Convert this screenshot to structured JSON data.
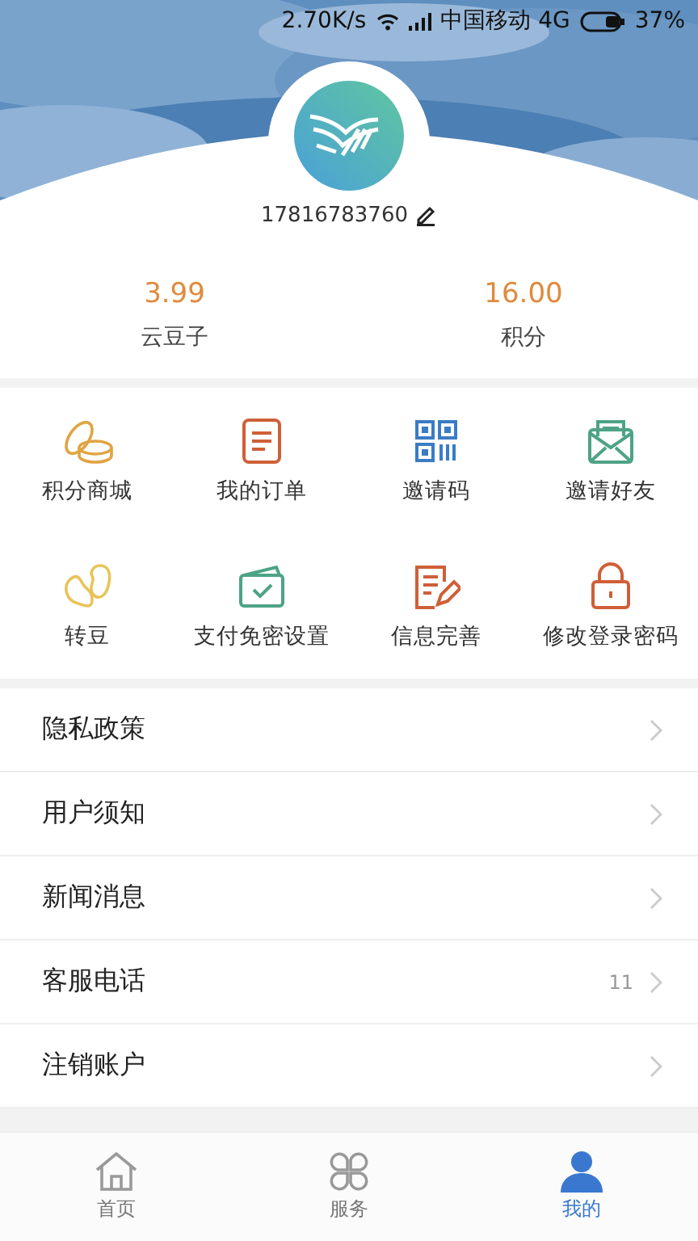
{
  "status_bar": {
    "speed": "2.70K/s",
    "carrier": "中国移动 4G",
    "battery": "37%"
  },
  "profile": {
    "phone": "17816783760"
  },
  "stats": [
    {
      "value": "3.99",
      "label": "云豆子"
    },
    {
      "value": "16.00",
      "label": "积分"
    }
  ],
  "shortcuts": [
    {
      "label": "积分商城"
    },
    {
      "label": "我的订单"
    },
    {
      "label": "邀请码"
    },
    {
      "label": "邀请好友"
    },
    {
      "label": "转豆"
    },
    {
      "label": "支付免密设置"
    },
    {
      "label": "信息完善"
    },
    {
      "label": "修改登录密码"
    }
  ],
  "menu": [
    {
      "label": "隐私政策"
    },
    {
      "label": "用户须知"
    },
    {
      "label": "新闻消息"
    },
    {
      "label": "客服电话",
      "value": "11"
    },
    {
      "label": "注销账户"
    }
  ],
  "tabs": [
    {
      "label": "首页",
      "selected": false
    },
    {
      "label": "服务",
      "selected": false
    },
    {
      "label": "我的",
      "selected": true
    }
  ]
}
